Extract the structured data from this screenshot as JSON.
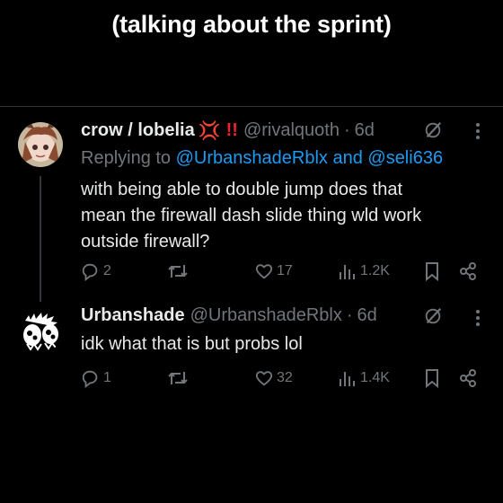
{
  "caption": "(talking about the sprint)",
  "tweets": [
    {
      "name": "crow / lobelia",
      "name_emoji": "💢",
      "name_suffix": "!!",
      "handle": "@rivalquoth",
      "dot": "·",
      "time": "6d",
      "replying_prefix": "Replying to",
      "replying_users": "@UrbanshadeRblx and @seli636",
      "text_lines": [
        "with being able to double jump does that",
        "mean the firewall dash slide thing wld work",
        "outside firewall?"
      ],
      "replies": "2",
      "retweets": "",
      "likes": "17",
      "views": "1.2K"
    },
    {
      "name": "Urbanshade",
      "handle": "@UrbanshadeRblx",
      "dot": "·",
      "time": "6d",
      "text_lines": [
        "idk what that is but probs lol"
      ],
      "replies": "1",
      "retweets": "",
      "likes": "32",
      "views": "1.4K"
    }
  ],
  "icons": {
    "reply": "reply-icon",
    "retweet": "retweet-icon",
    "like": "heart-icon",
    "views": "views-icon",
    "bookmark": "bookmark-icon",
    "share": "share-icon",
    "grok": "grok-icon",
    "more": "more-icon"
  },
  "colors": {
    "background": "#000000",
    "text": "#e7e9ea",
    "muted": "#71767b",
    "link": "#1d9bf0",
    "accent_red": "#f4212e"
  }
}
